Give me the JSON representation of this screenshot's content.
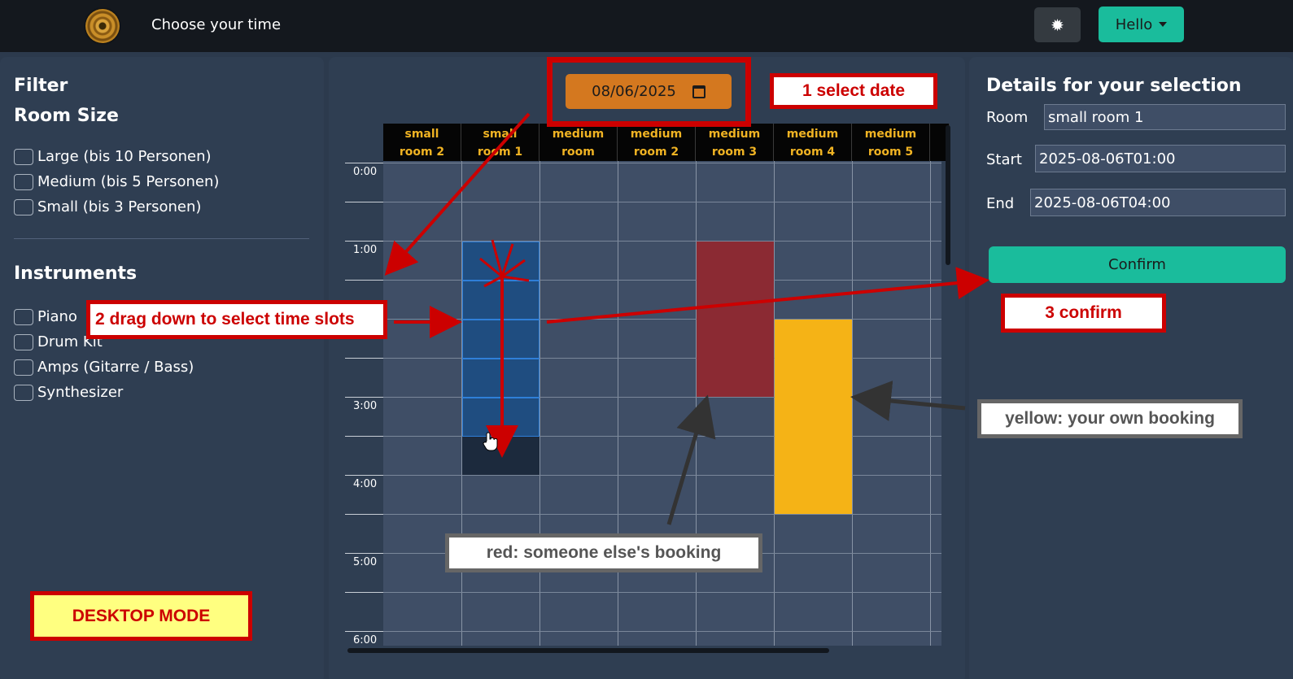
{
  "header": {
    "title": "Choose your time",
    "user_label": "Hello"
  },
  "filter": {
    "title": "Filter",
    "room_size_title": "Room Size",
    "room_sizes": [
      "Large (bis 10 Personen)",
      "Medium (bis 5 Personen)",
      "Small (bis 3 Personen)"
    ],
    "instruments_title": "Instruments",
    "instruments": [
      "Piano",
      "Drum Kit",
      "Amps (Gitarre / Bass)",
      "Synthesizer"
    ]
  },
  "calendar": {
    "date": "08/06/2025",
    "rooms": [
      {
        "line1": "small",
        "line2": "room 2"
      },
      {
        "line1": "small",
        "line2": "room 1"
      },
      {
        "line1": "medium",
        "line2": "room"
      },
      {
        "line1": "medium",
        "line2": "room 2"
      },
      {
        "line1": "medium",
        "line2": "room 3"
      },
      {
        "line1": "medium",
        "line2": "room 4"
      },
      {
        "line1": "medium",
        "line2": "room 5"
      }
    ],
    "times": [
      "0:00",
      "1:00",
      "3:00",
      "4:00",
      "5:00",
      "6:00"
    ]
  },
  "details": {
    "title": "Details for your selection",
    "room_label": "Room",
    "room_value": "small room 1",
    "start_label": "Start",
    "start_value": "2025-08-06T01:00",
    "end_label": "End",
    "end_value": "2025-08-06T04:00",
    "confirm_label": "Confirm"
  },
  "annotations": {
    "step1": "1 select date",
    "step2": "2 drag down to select time slots",
    "step3": "3 confirm",
    "yellow_note": "yellow: your own booking",
    "red_note": "red: someone else's booking",
    "mode": "DESKTOP MODE"
  },
  "colors": {
    "accent": "#1abc9c",
    "date_bg": "#d4781f",
    "selected": "#1f4d80",
    "booking_other": "#8b2a33",
    "booking_own": "#f5b316",
    "annotation": "#cc0000"
  }
}
